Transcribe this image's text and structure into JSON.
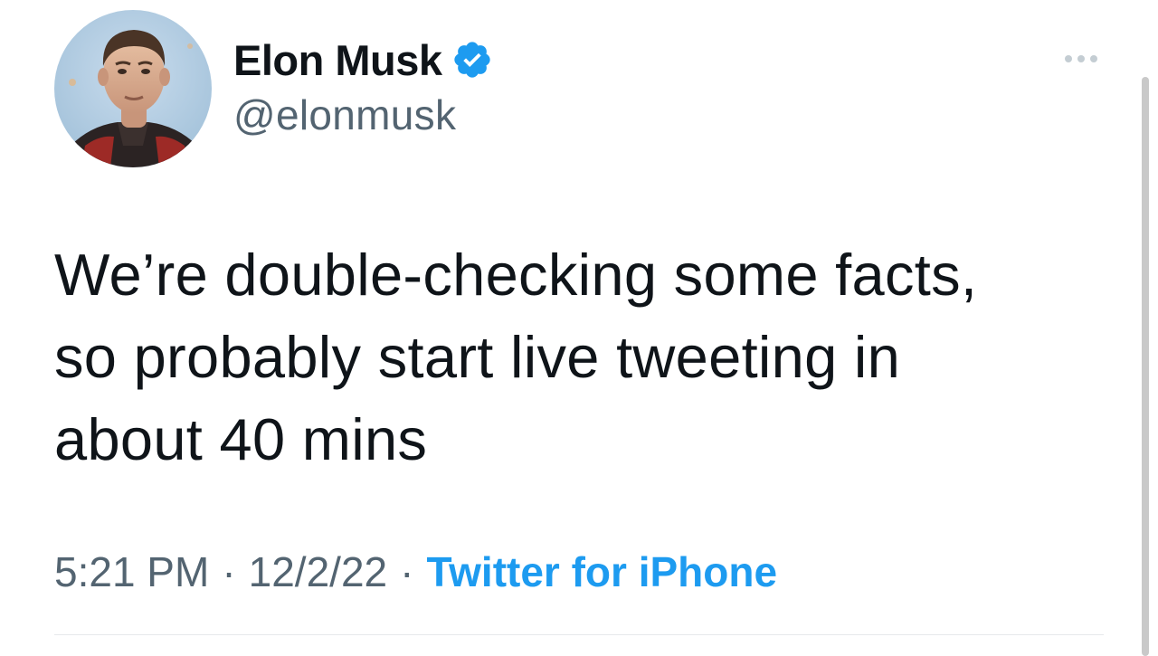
{
  "author": {
    "display_name": "Elon Musk",
    "handle": "@elonmusk",
    "verified": true,
    "verified_color": "#1d9bf0",
    "avatar_icon": "profile-photo"
  },
  "tweet": {
    "text": "We’re double-checking some facts,\nso probably start live tweeting in\nabout 40 mins"
  },
  "meta": {
    "time": "5:21 PM",
    "separator": "·",
    "date": "12/2/22",
    "source": "Twitter for iPhone",
    "source_color": "#1d9bf0"
  },
  "menu": {
    "icon": "more-horizontal-icon"
  }
}
